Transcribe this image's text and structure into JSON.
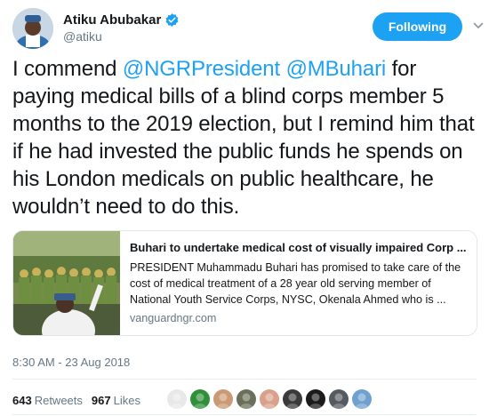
{
  "author": {
    "name": "Atiku Abubakar",
    "handle": "@atiku",
    "verified": true
  },
  "follow_button": {
    "label": "Following"
  },
  "tweet": {
    "segments": [
      {
        "text": "I commend ",
        "mention": false
      },
      {
        "text": "@NGRPresident",
        "mention": true
      },
      {
        "text": " ",
        "mention": false
      },
      {
        "text": "@MBuhari",
        "mention": true
      },
      {
        "text": " for paying medical bills of a blind corps member 5 months to the 2019 election, but I remind him that if he had invested the public funds he spends on his London medicals on public healthcare, he wouldn’t need to do this.",
        "mention": false
      }
    ]
  },
  "card": {
    "title": "Buhari to undertake medical cost of visually impaired Corp ...",
    "description": "PRESIDENT Muhammadu Buhari has promised to take care of the cost of medical treatment of a 28 year old serving member of National Youth Service Corps, NYSC, Okenala Ahmed who is ...",
    "domain": "vanguardngr.com"
  },
  "timestamp": "8:30 AM - 23 Aug 2018",
  "stats": {
    "retweets_count": "643",
    "retweets_label": "Retweets",
    "likes_count": "967",
    "likes_label": "Likes"
  },
  "colors": {
    "accent": "#1da1f2",
    "text": "#14171a",
    "muted": "#657786",
    "border": "#e1e8ed"
  },
  "likers": [
    {
      "icon": "liker-avatar-icon",
      "color": "#e8e8e8"
    },
    {
      "icon": "liker-avatar-icon",
      "color": "#2f8f3a"
    },
    {
      "icon": "liker-avatar-icon",
      "color": "#c99a74"
    },
    {
      "icon": "liker-avatar-icon",
      "color": "#6a6f5a"
    },
    {
      "icon": "liker-avatar-icon",
      "color": "#d9a18c"
    },
    {
      "icon": "liker-avatar-icon",
      "color": "#3a3a3a"
    },
    {
      "icon": "liker-avatar-icon",
      "color": "#1b1b1b"
    },
    {
      "icon": "liker-avatar-icon",
      "color": "#555a60"
    },
    {
      "icon": "liker-avatar-icon",
      "color": "#6fa0cf"
    }
  ]
}
